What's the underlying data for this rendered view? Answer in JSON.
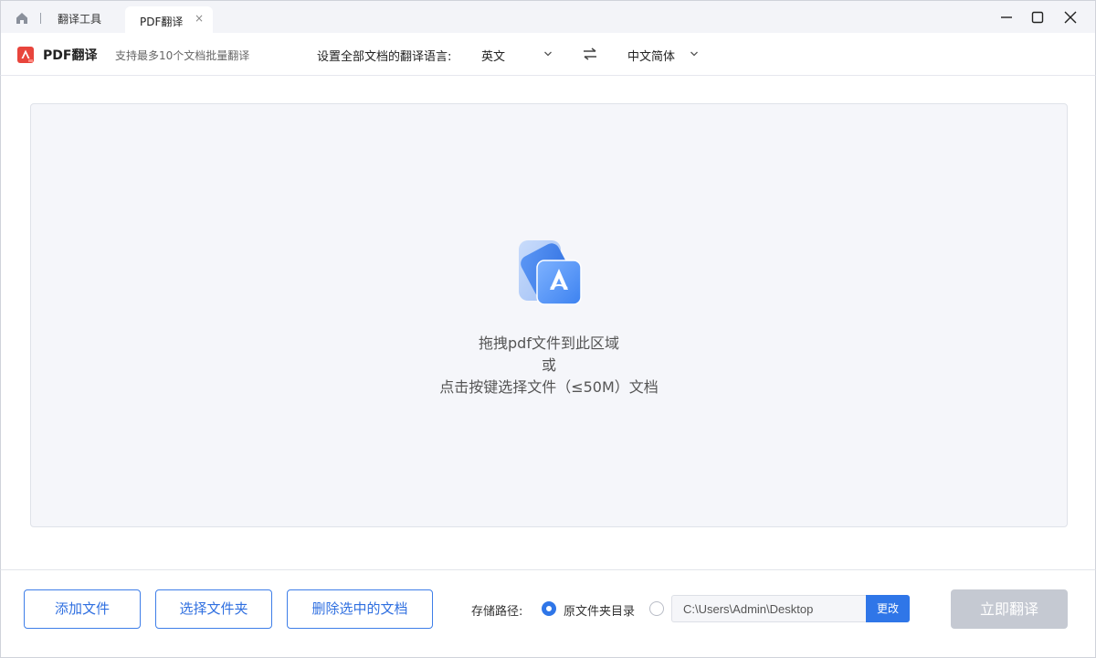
{
  "titlebar": {
    "home_icon": "home-icon",
    "tab_tools_label": "翻译工具",
    "active_tab_label": "PDF翻译",
    "tab_close": "×"
  },
  "header": {
    "app_title": "PDF翻译",
    "app_subtitle": "支持最多10个文档批量翻译",
    "lang_label": "设置全部文档的翻译语言:",
    "source_lang": "英文",
    "target_lang": "中文简体"
  },
  "dropzone": {
    "line1": "拖拽pdf文件到此区域",
    "line2": "或",
    "line3": "点击按键选择文件（≤50M）文档"
  },
  "footer": {
    "add_file": "添加文件",
    "select_folder": "选择文件夹",
    "delete_selected": "删除选中的文档",
    "save_path_label": "存储路径:",
    "radio_original": "原文件夹目录",
    "path_value": "C:\\Users\\Admin\\Desktop",
    "change_button": "更改",
    "translate_button": "立即翻译"
  },
  "colors": {
    "accent": "#2f76e8",
    "disabled": "#c5c9d2",
    "dropzone_bg": "#f5f6fa"
  }
}
